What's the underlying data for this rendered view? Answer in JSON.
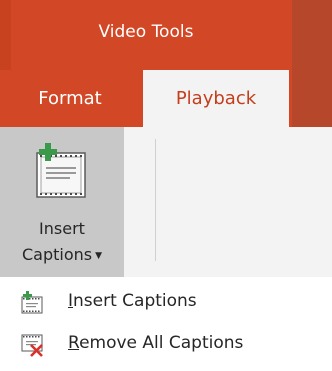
{
  "contextual_tab_group": {
    "title": "Video Tools"
  },
  "tabs": [
    {
      "label": "Format",
      "active": false
    },
    {
      "label": "Playback",
      "active": true
    }
  ],
  "ribbon": {
    "captions_button": {
      "label_line1": "Insert",
      "label_line2": "Captions",
      "icon": "insert-captions-icon",
      "has_dropdown": true
    }
  },
  "dropdown_menu": {
    "items": [
      {
        "mnemonic": "I",
        "rest": "nsert Captions",
        "icon": "insert-captions-icon"
      },
      {
        "mnemonic": "R",
        "rest": "emove All Captions",
        "icon": "remove-captions-icon"
      }
    ]
  },
  "colors": {
    "accent": "#d24726",
    "active_tab_text": "#c43e1c",
    "ribbon_bg": "#f3f3f3",
    "button_pressed": "#c8c8c8"
  }
}
